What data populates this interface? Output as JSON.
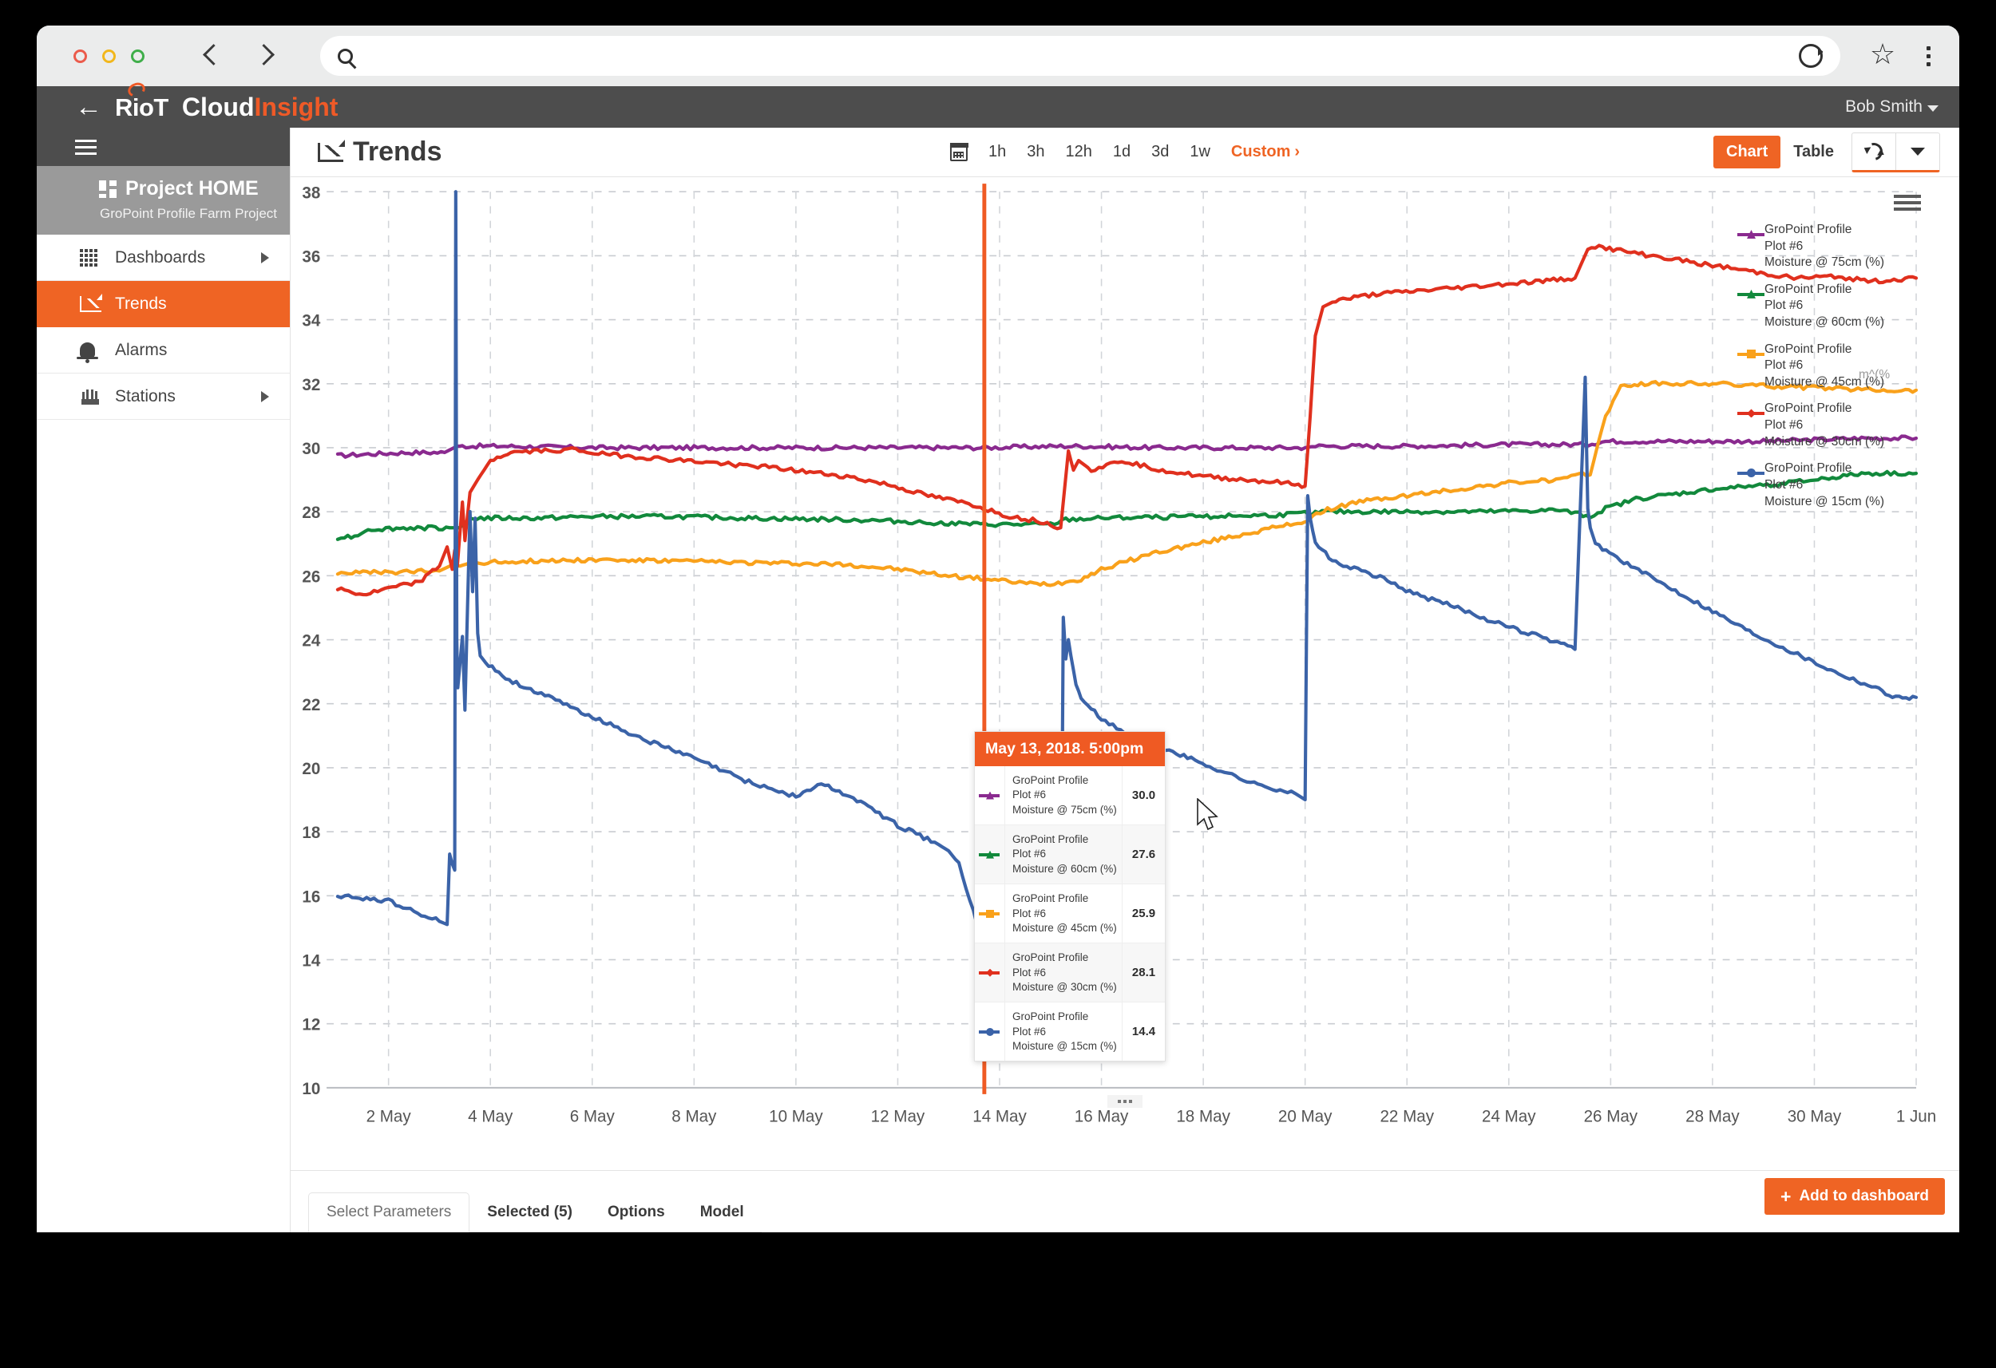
{
  "browser": {
    "back_icon": "back-arrow-icon",
    "forward_icon": "forward-arrow-icon",
    "address_value": "",
    "address_placeholder": "",
    "search_icon": "search-icon",
    "reload_icon": "reload-icon",
    "bookmark_icon": "star-icon",
    "menu_icon": "kebab-menu-icon"
  },
  "app": {
    "brand_riot": "RioT",
    "brand_cloud": "Cloud",
    "brand_insight": "Insight",
    "user_name": "Bob Smith"
  },
  "sidebar": {
    "project_title": "Project HOME",
    "project_subtitle": "GroPoint Profile Farm Project",
    "items": [
      {
        "label": "Dashboards",
        "icon": "grid-icon",
        "has_chevron": true,
        "active": false
      },
      {
        "label": "Trends",
        "icon": "trend-line-icon",
        "has_chevron": false,
        "active": true
      },
      {
        "label": "Alarms",
        "icon": "bell-icon",
        "has_chevron": false,
        "active": false
      },
      {
        "label": "Stations",
        "icon": "station-icon",
        "has_chevron": true,
        "active": false
      }
    ]
  },
  "toolbar": {
    "page_title": "Trends",
    "calendar_icon": "calendar-icon",
    "ranges": [
      "1h",
      "3h",
      "12h",
      "1d",
      "3d",
      "1w"
    ],
    "custom_label": "Custom",
    "custom_chevron": "›",
    "chart_label": "Chart",
    "table_label": "Table",
    "refresh_icon": "refresh-icon",
    "dropdown_icon": "chevron-down-icon"
  },
  "legend": {
    "menu_icon": "hamburger-menu-icon",
    "overlap_ghost_text": "m^(%",
    "items": [
      {
        "line1": "GroPoint Profile",
        "line2": "Plot #6",
        "line3": "Moisture @ 75cm (%)",
        "color": "#8a2a8f"
      },
      {
        "line1": "GroPoint Profile",
        "line2": "Plot #6",
        "line3": "Moisture @ 60cm (%)",
        "color": "#12893c"
      },
      {
        "line1": "GroPoint Profile",
        "line2": "Plot #6",
        "line3": "Moisture @ 45cm (%)",
        "color": "#f9a11b"
      },
      {
        "line1": "GroPoint Profile",
        "line2": "Plot #6",
        "line3": "Moisture @ 30cm (%)",
        "color": "#e0301e"
      },
      {
        "line1": "GroPoint Profile",
        "line2": "Plot #6",
        "line3": "Moisture @ 15cm (%)",
        "color": "#3b63a8"
      }
    ]
  },
  "tooltip": {
    "timestamp": "May 13, 2018. 5:00pm",
    "rows": [
      {
        "line1": "GroPoint Profile",
        "line2": "Plot #6",
        "line3": "Moisture @ 75cm (%)",
        "value": "30.0",
        "color": "#8a2a8f"
      },
      {
        "line1": "GroPoint Profile",
        "line2": "Plot #6",
        "line3": "Moisture @ 60cm (%)",
        "value": "27.6",
        "color": "#12893c"
      },
      {
        "line1": "GroPoint Profile",
        "line2": "Plot #6",
        "line3": "Moisture @ 45cm (%)",
        "value": "25.9",
        "color": "#f9a11b"
      },
      {
        "line1": "GroPoint Profile",
        "line2": "Plot #6",
        "line3": "Moisture @ 30cm (%)",
        "value": "28.1",
        "color": "#e0301e"
      },
      {
        "line1": "GroPoint Profile",
        "line2": "Plot #6",
        "line3": "Moisture @ 15cm (%)",
        "value": "14.4",
        "color": "#3b63a8"
      }
    ]
  },
  "footer": {
    "tabs": [
      {
        "label": "Select Parameters",
        "active": true
      },
      {
        "label": "Selected (5)",
        "active": false
      },
      {
        "label": "Options",
        "active": false
      },
      {
        "label": "Model",
        "active": false
      }
    ],
    "add_to_dashboard": "Add to dashboard",
    "plus_icon": "plus-icon",
    "drag_handle_icon": "drag-handle-icon"
  },
  "chart_data": {
    "type": "line",
    "title": "Trends",
    "xlabel": "",
    "ylabel": "",
    "ylim": [
      10,
      38
    ],
    "ytick_step": 2,
    "yticks": [
      10,
      12,
      14,
      16,
      18,
      20,
      22,
      24,
      26,
      28,
      30,
      32,
      34,
      36,
      38
    ],
    "xticks": [
      "2 May",
      "4 May",
      "6 May",
      "8 May",
      "10 May",
      "12 May",
      "14 May",
      "16 May",
      "18 May",
      "20 May",
      "22 May",
      "24 May",
      "26 May",
      "28 May",
      "30 May",
      "1 Jun"
    ],
    "x_range": [
      "1 May 2018",
      "1 Jun 2018"
    ],
    "grid": true,
    "legend_position": "right",
    "cursor_marker": {
      "label": "May 13, 2018. 5:00pm",
      "x_day": 13.7,
      "color": "#ef5a23"
    },
    "series": [
      {
        "name": "GroPoint Profile Plot #6 Moisture @ 75cm (%)",
        "color": "#8a2a8f",
        "x": [
          1.0,
          1.6,
          2.4,
          3.1,
          3.35,
          3.45,
          4.2,
          6.0,
          8.0,
          10.0,
          12.0,
          13.7,
          15.2,
          15.5,
          17.0,
          19.0,
          20.0,
          20.2,
          22.0,
          24.0,
          25.5,
          25.9,
          27.0,
          29.0,
          31.0,
          32.0
        ],
        "y": [
          29.75,
          29.8,
          29.85,
          29.85,
          30.05,
          30.05,
          30.05,
          30.0,
          30.0,
          30.0,
          30.0,
          30.0,
          30.05,
          30.05,
          30.0,
          30.0,
          30.0,
          30.05,
          30.05,
          30.1,
          30.1,
          30.2,
          30.2,
          30.2,
          30.3,
          30.3
        ]
      },
      {
        "name": "GroPoint Profile Plot #6 Moisture @ 60cm (%)",
        "color": "#12893c",
        "x": [
          1.0,
          1.4,
          1.6,
          2.5,
          3.2,
          3.4,
          3.6,
          5.0,
          6.0,
          7.5,
          9.0,
          11.0,
          12.0,
          13.7,
          15.0,
          15.3,
          16.0,
          18.0,
          19.5,
          20.0,
          20.4,
          22.0,
          23.5,
          25.0,
          25.6,
          25.9,
          26.5,
          28.0,
          29.5,
          31.0,
          32.0
        ],
        "y": [
          27.2,
          27.25,
          27.45,
          27.5,
          27.5,
          27.5,
          27.8,
          27.8,
          27.85,
          27.85,
          27.8,
          27.75,
          27.7,
          27.6,
          27.6,
          27.75,
          27.8,
          27.85,
          27.9,
          27.95,
          28.0,
          28.0,
          28.0,
          28.05,
          27.85,
          28.1,
          28.4,
          28.7,
          28.9,
          29.2,
          29.2
        ]
      },
      {
        "name": "GroPoint Profile Plot #6 Moisture @ 45cm (%)",
        "color": "#f9a11b",
        "x": [
          1.0,
          2.0,
          3.0,
          3.2,
          3.4,
          3.6,
          4.5,
          6.0,
          8.0,
          9.5,
          11.0,
          12.0,
          13.0,
          13.7,
          14.6,
          15.0,
          15.3,
          15.6,
          16.0,
          17.0,
          18.5,
          20.0,
          20.3,
          21.0,
          22.5,
          24.0,
          25.0,
          25.6,
          25.9,
          26.2,
          26.6,
          28.0,
          29.5,
          30.5,
          31.5,
          32.0
        ],
        "y": [
          26.1,
          26.1,
          26.15,
          26.3,
          26.3,
          26.4,
          26.45,
          26.5,
          26.45,
          26.4,
          26.35,
          26.2,
          26.0,
          25.9,
          25.75,
          25.75,
          25.8,
          25.9,
          26.2,
          26.7,
          27.2,
          27.7,
          28.0,
          28.3,
          28.6,
          28.9,
          29.0,
          29.2,
          31.0,
          31.9,
          32.0,
          32.0,
          31.9,
          31.85,
          31.8,
          31.8
        ]
      },
      {
        "name": "GroPoint Profile Plot #6 Moisture @ 30cm (%)",
        "color": "#e0301e",
        "x": [
          1.0,
          1.5,
          2.0,
          2.6,
          3.0,
          3.15,
          3.25,
          3.3,
          3.35,
          3.45,
          3.5,
          3.6,
          3.75,
          4.0,
          4.4,
          5.0,
          5.6,
          6.2,
          7.0,
          7.8,
          8.6,
          9.4,
          10.2,
          11.0,
          11.8,
          12.6,
          13.4,
          13.7,
          14.2,
          14.8,
          15.2,
          15.35,
          15.45,
          15.55,
          15.8,
          16.4,
          17.2,
          18.0,
          18.8,
          19.6,
          20.0,
          20.1,
          20.2,
          20.35,
          20.6,
          21.4,
          22.2,
          23.0,
          23.8,
          24.6,
          25.3,
          25.55,
          25.7,
          26.4,
          27.2,
          28.0,
          28.8,
          29.6,
          30.4,
          31.2,
          32.0
        ],
        "y": [
          25.6,
          25.4,
          25.6,
          25.8,
          26.3,
          26.9,
          26.2,
          26.8,
          26.3,
          28.3,
          27.1,
          28.6,
          29.0,
          29.6,
          29.85,
          29.9,
          29.95,
          29.8,
          29.7,
          29.6,
          29.5,
          29.4,
          29.25,
          29.1,
          28.85,
          28.5,
          28.25,
          28.1,
          27.85,
          27.7,
          27.5,
          29.9,
          29.3,
          29.6,
          29.3,
          29.6,
          29.3,
          29.1,
          29.0,
          28.9,
          28.8,
          31.0,
          33.5,
          34.4,
          34.6,
          34.8,
          34.9,
          35.0,
          35.1,
          35.2,
          35.3,
          36.2,
          36.3,
          36.1,
          35.9,
          35.7,
          35.5,
          35.3,
          35.35,
          35.2,
          35.3
        ]
      },
      {
        "name": "GroPoint Profile Plot #6 Moisture @ 15cm (%)",
        "color": "#3b63a8",
        "x": [
          1.0,
          1.5,
          2.0,
          2.5,
          3.0,
          3.15,
          3.2,
          3.25,
          3.3,
          3.32,
          3.34,
          3.36,
          3.45,
          3.5,
          3.6,
          3.65,
          3.7,
          3.75,
          3.8,
          3.9,
          4.3,
          5.0,
          6.0,
          7.0,
          8.0,
          9.0,
          9.6,
          10.0,
          10.5,
          11.2,
          12.0,
          12.8,
          13.0,
          13.2,
          13.7,
          14.4,
          15.0,
          15.2,
          15.25,
          15.3,
          15.35,
          15.4,
          15.5,
          15.6,
          16.0,
          16.6,
          17.4,
          18.2,
          19.0,
          19.8,
          20.0,
          20.05,
          20.1,
          20.2,
          20.6,
          21.4,
          22.2,
          23.0,
          23.8,
          24.6,
          25.3,
          25.5,
          25.55,
          25.6,
          25.7,
          26.4,
          27.2,
          28.0,
          28.8,
          29.6,
          30.4,
          31.2,
          31.6,
          32.0
        ],
        "y": [
          16.0,
          15.9,
          15.85,
          15.5,
          15.2,
          15.1,
          17.3,
          17.0,
          16.8,
          38.0,
          24.0,
          22.5,
          24.1,
          21.8,
          28.0,
          25.5,
          27.8,
          24.2,
          23.5,
          23.3,
          22.8,
          22.3,
          21.6,
          20.9,
          20.3,
          19.6,
          19.3,
          19.1,
          19.5,
          19.0,
          18.2,
          17.6,
          17.4,
          17.0,
          14.4,
          13.7,
          13.2,
          12.5,
          24.7,
          23.4,
          24.0,
          23.5,
          22.6,
          22.2,
          21.5,
          21.0,
          20.5,
          20.0,
          19.5,
          19.2,
          19.0,
          28.5,
          27.8,
          27.0,
          26.4,
          26.0,
          25.4,
          25.0,
          24.5,
          24.1,
          23.7,
          32.2,
          28.1,
          27.5,
          27.0,
          26.3,
          25.6,
          24.9,
          24.2,
          23.6,
          23.0,
          22.5,
          22.2,
          22.2
        ]
      }
    ]
  }
}
